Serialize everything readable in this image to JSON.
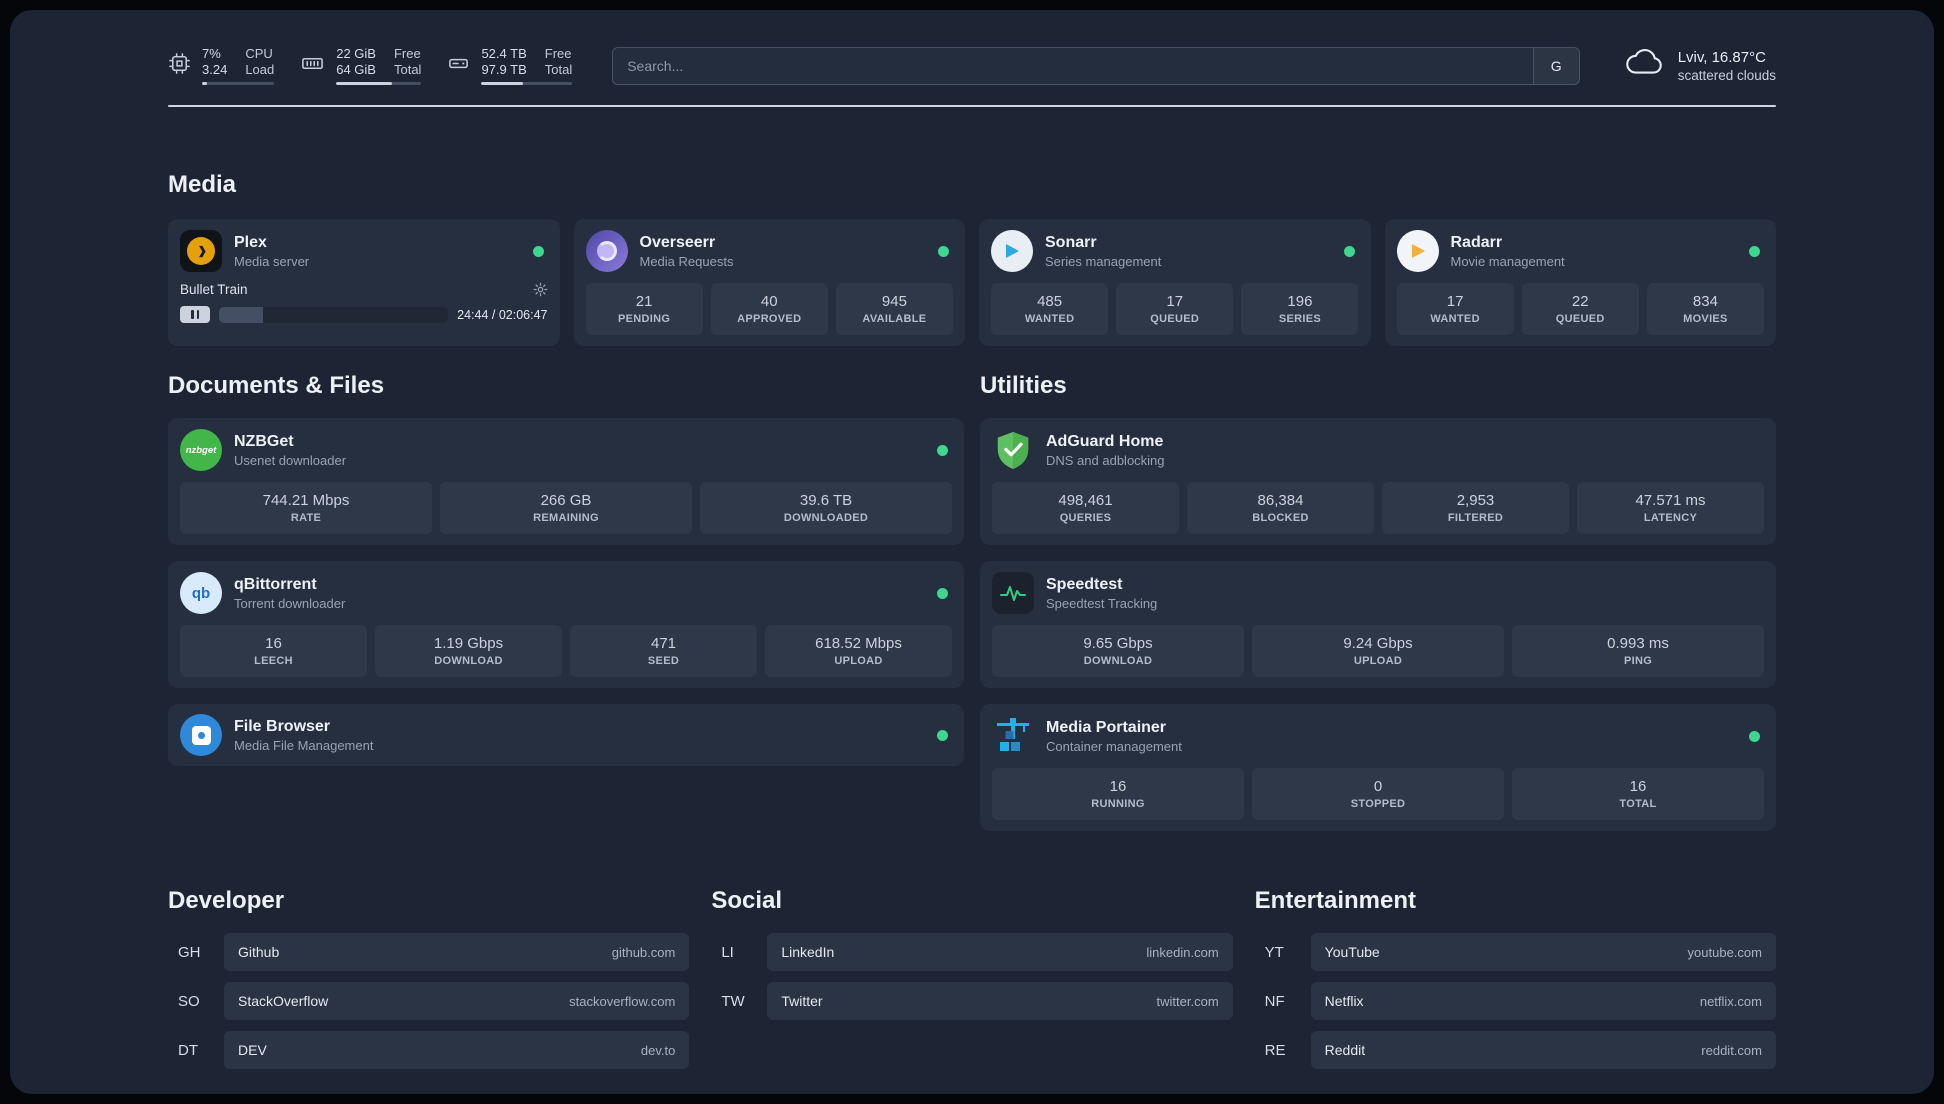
{
  "colors": {
    "status_online": "#3fd68f",
    "accent_plex": "#e5a00d",
    "accent_green": "#43b64a",
    "accent_blue": "#1fb2ea"
  },
  "header": {
    "resources": [
      {
        "name": "cpu",
        "value_top": "7%",
        "value_bottom": "3.24",
        "label_top": "CPU",
        "label_bottom": "Load",
        "percent": 7
      },
      {
        "name": "memory",
        "value_top": "22 GiB",
        "value_bottom": "64 GiB",
        "label_top": "Free",
        "label_bottom": "Total",
        "percent": 66
      },
      {
        "name": "disk",
        "value_top": "52.4 TB",
        "value_bottom": "97.9 TB",
        "label_top": "Free",
        "label_bottom": "Total",
        "percent": 46
      }
    ],
    "search": {
      "placeholder": "Search...",
      "provider_button": "G"
    },
    "weather": {
      "location": "Lviv, 16.87°C",
      "condition": "scattered clouds"
    }
  },
  "groups": {
    "media": {
      "title": "Media",
      "services": [
        {
          "name": "Plex",
          "description": "Media server",
          "now_playing": {
            "title": "Bullet Train",
            "time": "24:44 / 02:06:47",
            "progress": 19
          }
        },
        {
          "name": "Overseerr",
          "description": "Media Requests",
          "stats": [
            {
              "value": "21",
              "label": "PENDING"
            },
            {
              "value": "40",
              "label": "APPROVED"
            },
            {
              "value": "945",
              "label": "AVAILABLE"
            }
          ]
        },
        {
          "name": "Sonarr",
          "description": "Series management",
          "stats": [
            {
              "value": "485",
              "label": "WANTED"
            },
            {
              "value": "17",
              "label": "QUEUED"
            },
            {
              "value": "196",
              "label": "SERIES"
            }
          ]
        },
        {
          "name": "Radarr",
          "description": "Movie management",
          "stats": [
            {
              "value": "17",
              "label": "WANTED"
            },
            {
              "value": "22",
              "label": "QUEUED"
            },
            {
              "value": "834",
              "label": "MOVIES"
            }
          ]
        }
      ]
    },
    "documents": {
      "title": "Documents & Files",
      "services": [
        {
          "name": "NZBGet",
          "description": "Usenet downloader",
          "stats": [
            {
              "value": "744.21 Mbps",
              "label": "RATE"
            },
            {
              "value": "266 GB",
              "label": "REMAINING"
            },
            {
              "value": "39.6 TB",
              "label": "DOWNLOADED"
            }
          ]
        },
        {
          "name": "qBittorrent",
          "description": "Torrent downloader",
          "stats": [
            {
              "value": "16",
              "label": "LEECH"
            },
            {
              "value": "1.19 Gbps",
              "label": "DOWNLOAD"
            },
            {
              "value": "471",
              "label": "SEED"
            },
            {
              "value": "618.52 Mbps",
              "label": "UPLOAD"
            }
          ]
        },
        {
          "name": "File Browser",
          "description": "Media File Management",
          "stats": []
        }
      ]
    },
    "utilities": {
      "title": "Utilities",
      "services": [
        {
          "name": "AdGuard Home",
          "description": "DNS and adblocking",
          "stats": [
            {
              "value": "498,461",
              "label": "QUERIES"
            },
            {
              "value": "86,384",
              "label": "BLOCKED"
            },
            {
              "value": "2,953",
              "label": "FILTERED"
            },
            {
              "value": "47.571 ms",
              "label": "LATENCY"
            }
          ]
        },
        {
          "name": "Speedtest",
          "description": "Speedtest Tracking",
          "stats": [
            {
              "value": "9.65 Gbps",
              "label": "DOWNLOAD"
            },
            {
              "value": "9.24 Gbps",
              "label": "UPLOAD"
            },
            {
              "value": "0.993 ms",
              "label": "PING"
            }
          ]
        },
        {
          "name": "Media Portainer",
          "description": "Container management",
          "stats": [
            {
              "value": "16",
              "label": "RUNNING"
            },
            {
              "value": "0",
              "label": "STOPPED"
            },
            {
              "value": "16",
              "label": "TOTAL"
            }
          ]
        }
      ]
    }
  },
  "bookmark_groups": [
    {
      "title": "Developer",
      "bookmarks": [
        {
          "abbr": "GH",
          "name": "Github",
          "url": "github.com"
        },
        {
          "abbr": "SO",
          "name": "StackOverflow",
          "url": "stackoverflow.com"
        },
        {
          "abbr": "DT",
          "name": "DEV",
          "url": "dev.to"
        }
      ]
    },
    {
      "title": "Social",
      "bookmarks": [
        {
          "abbr": "LI",
          "name": "LinkedIn",
          "url": "linkedin.com"
        },
        {
          "abbr": "TW",
          "name": "Twitter",
          "url": "twitter.com"
        }
      ]
    },
    {
      "title": "Entertainment",
      "bookmarks": [
        {
          "abbr": "YT",
          "name": "YouTube",
          "url": "youtube.com"
        },
        {
          "abbr": "NF",
          "name": "Netflix",
          "url": "netflix.com"
        },
        {
          "abbr": "RE",
          "name": "Reddit",
          "url": "reddit.com"
        }
      ]
    }
  ]
}
